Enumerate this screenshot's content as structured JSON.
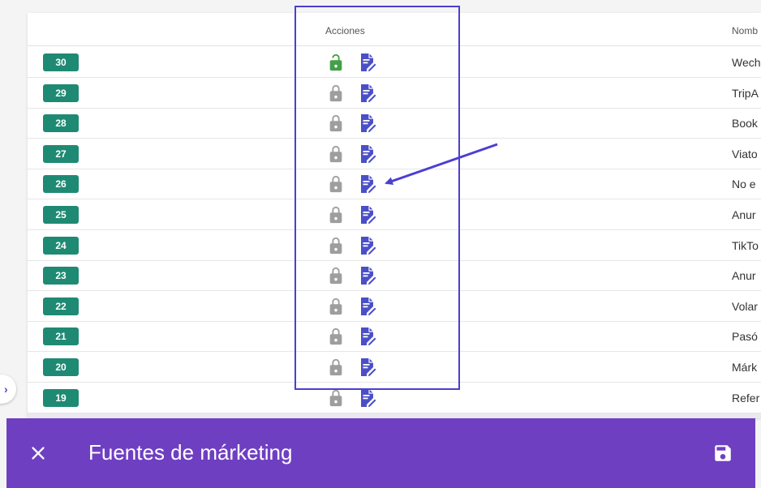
{
  "table": {
    "columns": {
      "actions": "Acciones",
      "name": "Nomb"
    },
    "rows": [
      {
        "id": "30",
        "name": "Wech",
        "unlocked": true
      },
      {
        "id": "29",
        "name": "TripA",
        "unlocked": false
      },
      {
        "id": "28",
        "name": "Book",
        "unlocked": false
      },
      {
        "id": "27",
        "name": "Viato",
        "unlocked": false
      },
      {
        "id": "26",
        "name": "No e",
        "unlocked": false
      },
      {
        "id": "25",
        "name": "Anur",
        "unlocked": false
      },
      {
        "id": "24",
        "name": "TikTo",
        "unlocked": false
      },
      {
        "id": "23",
        "name": "Anur",
        "unlocked": false
      },
      {
        "id": "22",
        "name": "Volar",
        "unlocked": false
      },
      {
        "id": "21",
        "name": "Pasó",
        "unlocked": false
      },
      {
        "id": "20",
        "name": "Márk",
        "unlocked": false
      },
      {
        "id": "19",
        "name": "Refer",
        "unlocked": false
      }
    ]
  },
  "bottom_bar": {
    "title": "Fuentes de márketing"
  },
  "icons": {
    "lock_locked": "lock-icon",
    "lock_unlocked": "unlocked-lock-icon",
    "edit": "edit-document-icon",
    "close": "close-icon",
    "save": "save-icon"
  },
  "colors": {
    "badge": "#1f8a73",
    "lock_locked": "#9e9e9e",
    "lock_unlocked": "#43a047",
    "edit": "#4b4fc7",
    "annotation": "#4c3fd0",
    "bar": "#6f3fc2"
  }
}
